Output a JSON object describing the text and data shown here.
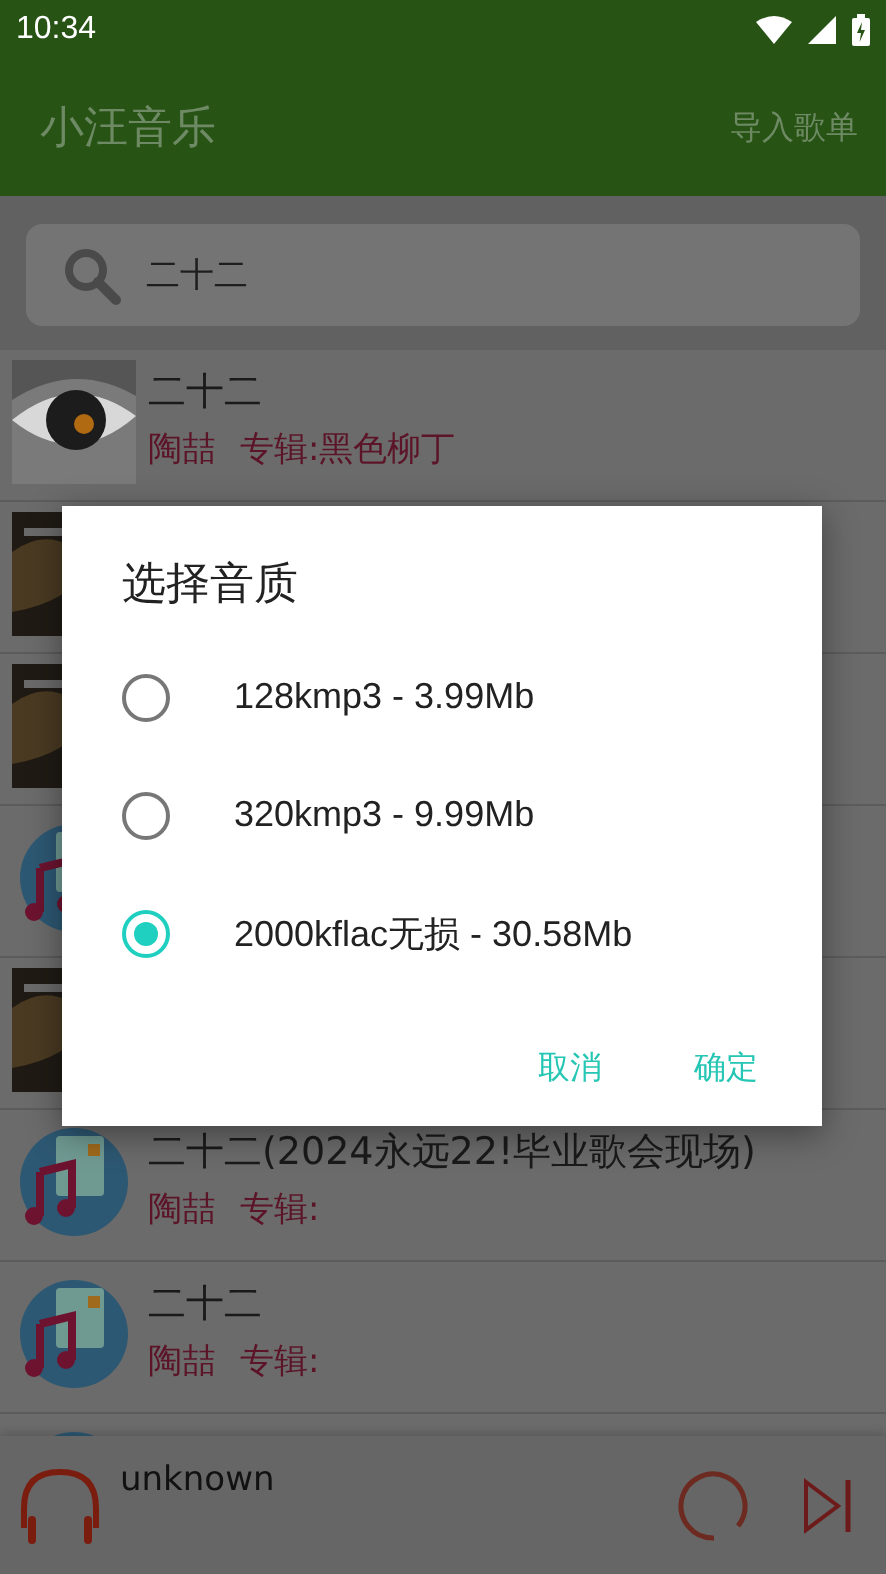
{
  "status_bar": {
    "time": "10:34"
  },
  "app_bar": {
    "title": "小汪音乐",
    "action": "导入歌单"
  },
  "search": {
    "value": "二十二"
  },
  "songs": [
    {
      "kind": "picture",
      "title": "二十二",
      "artist": "陶喆",
      "album": "专辑:黑色柳丁"
    },
    {
      "kind": "picture"
    },
    {
      "kind": "picture"
    },
    {
      "kind": "music-icon"
    },
    {
      "kind": "picture"
    },
    {
      "kind": "music-icon",
      "title": "二十二(2024永远22!毕业歌会现场)",
      "artist": "陶喆",
      "album": "专辑:"
    },
    {
      "kind": "music-icon",
      "title": "二十二",
      "artist": "陶喆",
      "album": "专辑:"
    },
    {
      "kind": "music-icon"
    }
  ],
  "player": {
    "track": "unknown"
  },
  "dialog": {
    "title": "选择音质",
    "options": [
      {
        "label": "128kmp3 - 3.99Mb",
        "selected": false
      },
      {
        "label": "320kmp3 - 9.99Mb",
        "selected": false
      },
      {
        "label": "2000kflac无损 - 30.58Mb",
        "selected": true
      }
    ],
    "buttons": [
      "取消",
      "确定"
    ]
  }
}
